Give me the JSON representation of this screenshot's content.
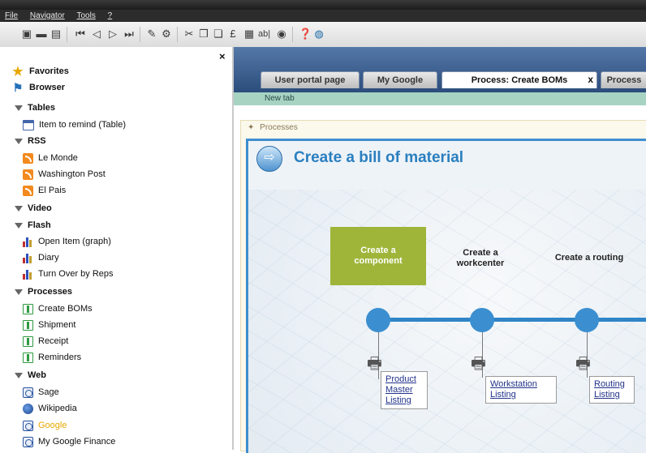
{
  "menu": [
    "File",
    "Navigator",
    "Tools",
    "?"
  ],
  "toolbar_icons": [
    "save-icon",
    "print-icon",
    "preview-icon",
    "first-icon",
    "previous-icon",
    "next-icon",
    "last-icon",
    "attach-icon",
    "settings-icon",
    "cut-icon",
    "copy-icon",
    "paste-icon",
    "edit-icon",
    "document-icon",
    "text-field-icon",
    "disk-icon",
    "help-icon",
    "web-help-icon"
  ],
  "sidebar": {
    "close": "×",
    "favorites": "Favorites",
    "browser": "Browser",
    "sections": [
      {
        "title": "Tables",
        "items": [
          "Item to remind (Table)"
        ]
      },
      {
        "title": "RSS",
        "items": [
          "Le Monde",
          "Washington Post",
          "El Pais"
        ]
      },
      {
        "title": "Video",
        "items": []
      },
      {
        "title": "Flash",
        "items": [
          "Open Item (graph)",
          "Diary",
          "Turn Over by Reps"
        ]
      },
      {
        "title": "Processes",
        "items": [
          "Create BOMs",
          "Shipment",
          "Receipt",
          "Reminders"
        ]
      },
      {
        "title": "Web",
        "items": [
          "Sage",
          "Wikipedia",
          "Google",
          "My Google Finance"
        ]
      }
    ]
  },
  "tabs": [
    "User portal page",
    "My Google",
    "Process: Create BOMs",
    "Process"
  ],
  "tab_close": "x",
  "new_tab": "New tab",
  "panel": {
    "header": "Processes",
    "title": "Create a bill of material",
    "steps": [
      "Create a component",
      "Create a workcenter",
      "Create a routing"
    ],
    "listings": [
      "Product Master Listing",
      "Workstation Listing",
      "Routing Listing"
    ]
  },
  "colors": {
    "accent": "#2f85c8",
    "step_active": "#9fb53a",
    "tab_bar": "#2b4d7c",
    "new_tab_bar": "#a7d3c3"
  }
}
